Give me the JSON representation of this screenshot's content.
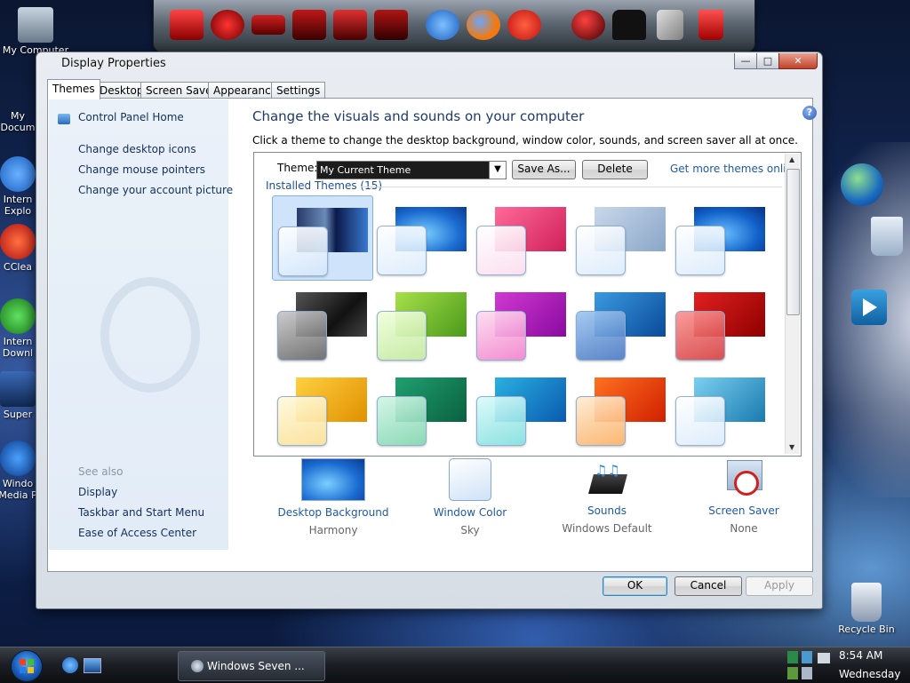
{
  "desktop": {
    "icons_left": [
      {
        "label": "My Computer"
      },
      {
        "label": "My Docum"
      },
      {
        "label": "Intern Explo"
      },
      {
        "label": "CClea"
      },
      {
        "label": "Intern Downl"
      },
      {
        "label": "Super"
      },
      {
        "label": "Windo Media P"
      }
    ],
    "recycle_bin_label": "Recycle Bin"
  },
  "window": {
    "title": "Display Properties",
    "tabs": [
      "Themes",
      "Desktop",
      "Screen Saver",
      "Appearance",
      "Settings"
    ],
    "active_tab": "Themes",
    "left_pane": {
      "control_panel_home": "Control Panel Home",
      "links": [
        "Change desktop icons",
        "Change mouse pointers",
        "Change your account picture"
      ],
      "see_also": "See also",
      "see_also_links": [
        "Display",
        "Taskbar and Start Menu",
        "Ease of Access Center"
      ]
    },
    "heading": "Change the visuals and sounds on your computer",
    "subtext": "Click a theme to change the desktop background, window color, sounds, and screen saver all at once.",
    "theme_label": "Theme:",
    "theme_value": "My Current Theme",
    "save_as": "Save As...",
    "delete": "Delete",
    "more_themes": "Get more themes online",
    "installed_label": "Installed Themes (15)",
    "customize": [
      {
        "label": "Desktop Background",
        "value": "Harmony"
      },
      {
        "label": "Window Color",
        "value": "Sky"
      },
      {
        "label": "Sounds",
        "value": "Windows Default"
      },
      {
        "label": "Screen Saver",
        "value": "None"
      }
    ],
    "ok": "OK",
    "cancel": "Cancel",
    "apply": "Apply"
  },
  "taskbar": {
    "task_label": "Windows Seven ...",
    "clock_time": "8:54 AM",
    "clock_day": "Wednesday"
  },
  "colors": {
    "link_blue": "#1e5aa8",
    "heading_blue": "#1e3a6b",
    "selected_tile": "#cfe4fb"
  }
}
